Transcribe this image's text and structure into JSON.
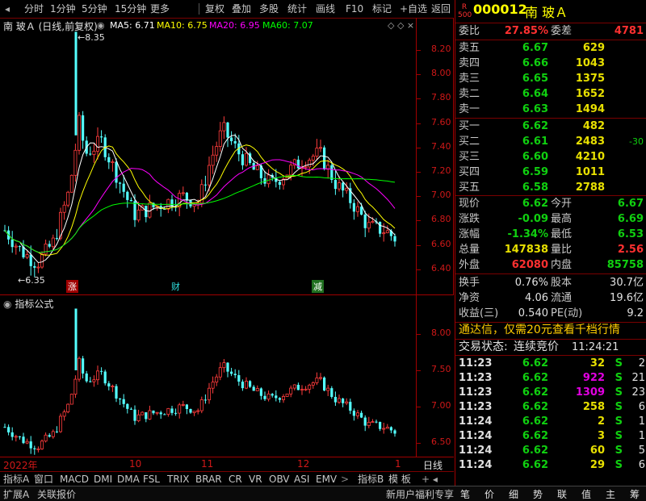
{
  "toolbar": {
    "items": [
      "分时",
      "1分钟",
      "5分钟",
      "15分钟",
      "更多",
      "复权",
      "叠加",
      "多股",
      "统计",
      "画线",
      "F10",
      "标记",
      "+自选",
      "返回"
    ]
  },
  "kline": {
    "title": "南 玻Ａ (日线,前复权)",
    "ma5": "MA5: 6.71",
    "ma10": "MA10: 6.75",
    "ma20": "MA20: 6.95",
    "ma60": "MA60: 7.07",
    "high_marker": "8.35",
    "low_marker": "6.35",
    "price_ticks": [
      "8.20",
      "8.00",
      "7.80",
      "7.60",
      "7.40",
      "7.20",
      "7.00",
      "6.80",
      "6.60",
      "6.40"
    ],
    "event_markers": [
      "涨",
      "财",
      "减"
    ],
    "colors": {
      "up": "#ff3c3c",
      "down": "#54ffff",
      "ma5": "#ffffff",
      "ma10": "#ffff00",
      "ma20": "#ff00ff",
      "ma60": "#00ff00"
    }
  },
  "indicator": {
    "title": "指标公式",
    "ticks": [
      "8.00",
      "7.50",
      "7.00",
      "6.50"
    ]
  },
  "date_axis": {
    "labels": [
      "2022年",
      "10",
      "11",
      "12",
      "1"
    ],
    "period": "日线"
  },
  "tabs": [
    "指标A",
    "窗口",
    "MACD",
    "DMI",
    "DMA",
    "FSL",
    "TRIX",
    "BRAR",
    "CR",
    "VR",
    "OBV",
    "ASI",
    "EMV",
    "指标B",
    "模 板"
  ],
  "status": {
    "left1": "扩展A",
    "left2": "关联报价",
    "center": "新用户福利专享"
  },
  "status_icons": [
    "笔",
    "价",
    "细",
    "势",
    "联",
    "值",
    "主",
    "筹"
  ],
  "quote": {
    "badge": "R 500",
    "code": "000012",
    "name": "南 玻Ａ",
    "weibi_label": "委比",
    "weibi": "27.85%",
    "weicha_label": "委差",
    "weicha": "4781",
    "sells": [
      {
        "label": "卖五",
        "price": "6.67",
        "vol": "629"
      },
      {
        "label": "卖四",
        "price": "6.66",
        "vol": "1043"
      },
      {
        "label": "卖三",
        "price": "6.65",
        "vol": "1375"
      },
      {
        "label": "卖二",
        "price": "6.64",
        "vol": "1652"
      },
      {
        "label": "卖一",
        "price": "6.63",
        "vol": "1494"
      }
    ],
    "buys": [
      {
        "label": "买一",
        "price": "6.62",
        "vol": "482",
        "chg": ""
      },
      {
        "label": "买二",
        "price": "6.61",
        "vol": "2483",
        "chg": "-30"
      },
      {
        "label": "买三",
        "price": "6.60",
        "vol": "4210",
        "chg": ""
      },
      {
        "label": "买四",
        "price": "6.59",
        "vol": "1011",
        "chg": ""
      },
      {
        "label": "买五",
        "price": "6.58",
        "vol": "2788",
        "chg": ""
      }
    ],
    "stats": [
      {
        "l1": "现价",
        "v1": "6.62",
        "l2": "今开",
        "v2": "6.67"
      },
      {
        "l1": "涨跌",
        "v1": "-0.09",
        "l2": "最高",
        "v2": "6.69"
      },
      {
        "l1": "涨幅",
        "v1": "-1.34%",
        "l2": "最低",
        "v2": "6.53"
      },
      {
        "l1": "总量",
        "v1": "147838",
        "l2": "量比",
        "v2": "2.56"
      },
      {
        "l1": "外盘",
        "v1": "62080",
        "l2": "内盘",
        "v2": "85758"
      }
    ],
    "stats2": [
      {
        "l1": "换手",
        "v1": "0.76%",
        "l2": "股本",
        "v2": "30.7亿"
      },
      {
        "l1": "净资",
        "v1": "4.06",
        "l2": "流通",
        "v2": "19.6亿"
      },
      {
        "l1": "收益(三)",
        "v1": "0.540",
        "l2": "PE(动)",
        "v2": "9.2"
      }
    ],
    "promo": "通达信，仅需20元查看千档行情",
    "trade_status_label": "交易状态:",
    "trade_status": "连续竞价",
    "trade_time": "11:24:21",
    "ticks": [
      {
        "t": "11:23",
        "p": "6.62",
        "v": "32",
        "s": "S",
        "n": "2"
      },
      {
        "t": "11:23",
        "p": "6.62",
        "v": "922",
        "s": "S",
        "n": "21"
      },
      {
        "t": "11:23",
        "p": "6.62",
        "v": "1309",
        "s": "S",
        "n": "23"
      },
      {
        "t": "11:23",
        "p": "6.62",
        "v": "258",
        "s": "S",
        "n": "6"
      },
      {
        "t": "11:24",
        "p": "6.62",
        "v": "2",
        "s": "S",
        "n": "1"
      },
      {
        "t": "11:24",
        "p": "6.62",
        "v": "3",
        "s": "S",
        "n": "1"
      },
      {
        "t": "11:24",
        "p": "6.62",
        "v": "60",
        "s": "S",
        "n": "5"
      },
      {
        "t": "11:24",
        "p": "6.62",
        "v": "29",
        "s": "S",
        "n": "6"
      }
    ]
  }
}
